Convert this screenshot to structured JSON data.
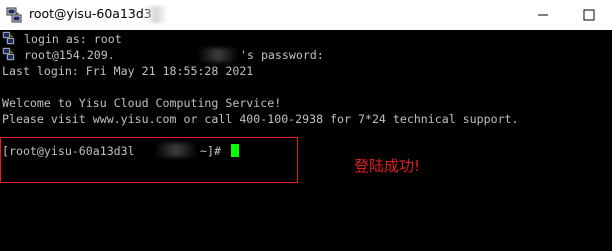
{
  "window": {
    "title": "root@yisu-60a13d3",
    "icon": "putty-icon"
  },
  "terminal": {
    "lines": [
      "login as: root",
      "root@154.209.",
      "'s password:",
      "Last login: Fri May 21 18:55:28 2021",
      "Welcome to Yisu Cloud Computing Service!",
      "Please visit www.yisu.com or call 400-100-2938 for 7*24 technical support."
    ],
    "prompt_prefix": "[root@yisu-60a13d3l",
    "prompt_suffix": "~]#",
    "cursor_color": "#00ff00",
    "text_color": "#c0c0c0"
  },
  "annotation": {
    "text": "登陆成功!",
    "color": "#e21b1b"
  }
}
